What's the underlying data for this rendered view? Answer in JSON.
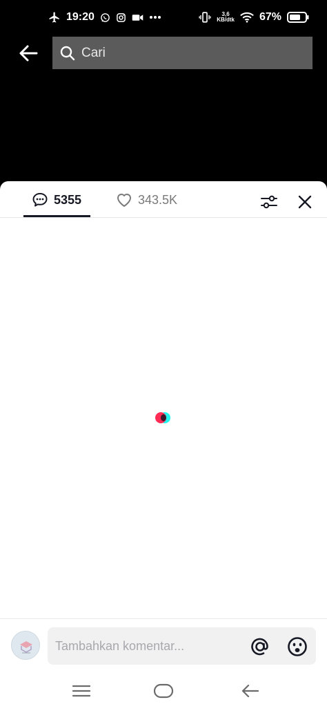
{
  "status_bar": {
    "time": "19:20",
    "speed_value": "3,6",
    "speed_unit": "KB/dtk",
    "battery": "67%"
  },
  "search": {
    "placeholder": "Cari"
  },
  "comments_sheet": {
    "comment_count": "5355",
    "like_count": "343.5K"
  },
  "comment_input": {
    "placeholder": "Tambahkan komentar..."
  },
  "colors": {
    "accent_red": "#fe2c55",
    "accent_cyan": "#25f4ee",
    "text_primary": "#161823"
  }
}
